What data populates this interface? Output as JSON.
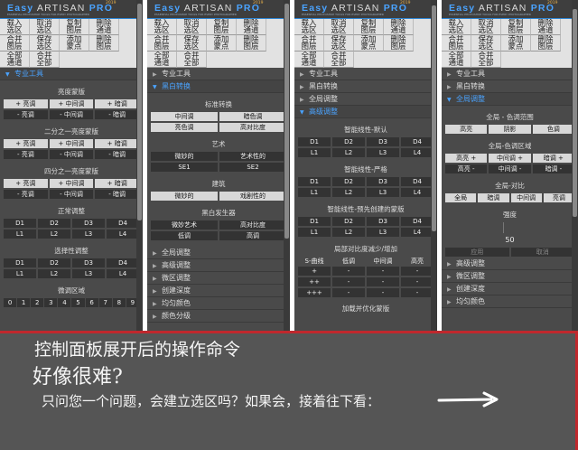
{
  "brand": {
    "logo_prefix": "Easy",
    "logo_name": "ARTISAN",
    "logo_suffix": "PRO",
    "logo_version": "2019",
    "tagline": "ESSENTIAL PHOTOSHOP TOOLS FOR EVERY PHOTOGRAPHER",
    "accent": "#4aa3ff"
  },
  "toolbar": {
    "row1": [
      "载入\n选区",
      "取消\n选区",
      "复制\n图层",
      "删除\n通道",
      "合并\n图层"
    ],
    "row2": [
      "保存\n选区",
      "添加\n蒙点",
      "删除\n图层",
      "全部\n通道",
      "合并\n全部"
    ]
  },
  "p1": {
    "section": "专业工具",
    "h1": "亮度蒙版",
    "r1": [
      "+ 亮调",
      "+ 中间调",
      "+ 暗调"
    ],
    "r2": [
      "- 亮调",
      "- 中间调",
      "- 暗调"
    ],
    "h2": "二分之一亮度蒙版",
    "r3": [
      "+ 亮调",
      "+ 中间调",
      "+ 暗调"
    ],
    "r4": [
      "- 亮调",
      "- 中间调",
      "- 暗调"
    ],
    "h3": "四分之一亮度蒙版",
    "r5": [
      "+ 亮调",
      "+ 中间调",
      "+ 暗调"
    ],
    "r6": [
      "- 亮调",
      "- 中间调",
      "- 暗调"
    ],
    "h4": "正常调整",
    "d": [
      "D1",
      "D2",
      "D3",
      "D4"
    ],
    "l": [
      "L1",
      "L2",
      "L3",
      "L4"
    ],
    "h5": "选择性调整",
    "h6": "微调区域",
    "nums": [
      "0",
      "1",
      "2",
      "3",
      "4",
      "5",
      "6",
      "7",
      "8",
      "9"
    ]
  },
  "p2": {
    "sections": [
      "专业工具",
      "黑白转换"
    ],
    "h1": "标准转换",
    "r1": [
      "中间调",
      "暗色调"
    ],
    "r2": [
      "亮色调",
      "高对比度"
    ],
    "h2": "艺术",
    "r3": [
      "微妙的",
      "艺术性的"
    ],
    "r4": [
      "SE1",
      "SE2"
    ],
    "h3": "建筑",
    "r5": [
      "微妙的",
      "戏剧性的"
    ],
    "h4": "黑白发生器",
    "r6": [
      "微妙艺术",
      "高对比度"
    ],
    "r7": [
      "低调",
      "高调"
    ],
    "bottom": [
      "全局调整",
      "高级调整",
      "微区调整",
      "创建深度",
      "均匀颜色",
      "颜色分级"
    ]
  },
  "p3": {
    "sections": [
      "专业工具",
      "黑白转换",
      "全局调整",
      "高级调整"
    ],
    "h1": "智能线性-默认",
    "d": [
      "D1",
      "D2",
      "D3",
      "D4"
    ],
    "l": [
      "L1",
      "L2",
      "L3",
      "L4"
    ],
    "h2": "智能线性-严格",
    "h3": "智能线性-预先创建的蒙版",
    "h4": "局部对比度减少/增加",
    "curve_head": [
      "S-曲线",
      "低调",
      "中间调",
      "高亮"
    ],
    "curve_rows": [
      [
        "+",
        "-",
        "-",
        "-"
      ],
      [
        "++",
        "-",
        "-",
        "-"
      ],
      [
        "+++",
        "-",
        "-",
        "-"
      ]
    ],
    "h5": "加载并优化蒙版"
  },
  "p4": {
    "sections": [
      "专业工具",
      "黑白转换",
      "全局调整"
    ],
    "h1": "全局 - 色调范围",
    "r1": [
      "高亮",
      "阴影",
      "色调"
    ],
    "h2": "全局-色调区域",
    "r2": [
      "高亮 +",
      "中间调 +",
      "暗调 +"
    ],
    "r3": [
      "高亮 -",
      "中间调 -",
      "暗调 -"
    ],
    "h3": "全局-对比",
    "r4": [
      "全局",
      "暗调",
      "中间调",
      "亮调"
    ],
    "h4": "强度",
    "value": "50",
    "r5": [
      "应用",
      "取消"
    ],
    "bottom": [
      "高级调整",
      "微区调整",
      "创建深度",
      "均匀颜色"
    ]
  },
  "caption": {
    "line1": "控制面板展开后的操作命令",
    "line2": "好像很难?",
    "line3": "只问您一个问题，会建立选区吗？如果会，接着往下看："
  },
  "colors": {
    "panel_bg": "#4a4a4a",
    "caption_bg": "#555555",
    "border_red": "#c0282d"
  }
}
